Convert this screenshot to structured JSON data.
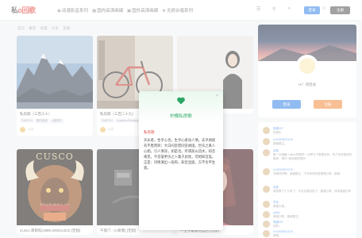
{
  "header": {
    "logo_main": "私",
    "logo_accent": "o回歌",
    "nav": [
      {
        "icon": "◉",
        "label": "动漫影音系列"
      },
      {
        "icon": "▦",
        "label": "国内高清画媒"
      },
      {
        "icon": "▣",
        "label": "国外高清画媒"
      },
      {
        "icon": "★",
        "label": "无损合唱系列"
      }
    ],
    "login_label": "登录",
    "register_label": "注册"
  },
  "breadcrumb": [
    "首页",
    "推荐",
    "动漫",
    "分享",
    "资源"
  ],
  "cards": [
    {
      "title": "私房歌（三百三十）",
      "tags": [
        "SWITCH",
        "国内高清",
        "U盘音乐"
      ],
      "author": "小闪"
    },
    {
      "title": "私房歌（三百二十九）",
      "tags": [
        "SWITCH",
        "Lossless Reading"
      ],
      "author": "小闪"
    },
    {
      "title": "",
      "tags": [],
      "author": ""
    },
    {
      "title": "Cusco 库斯科(1985-2004)14CD [无损]",
      "tags": [],
      "author": ""
    },
    {
      "title": "午夜门 - (A爱情) [无损]",
      "tags": [],
      "author": ""
    },
    {
      "title": "一生中最爱的自己 [无损]",
      "tags": [],
      "author": ""
    }
  ],
  "album_art": {
    "cusco_logo": "CUSCO",
    "cusco_sub": "APURIMAC III"
  },
  "sidebar": {
    "greeting": "Hi！请登录",
    "btn_login": "登录",
    "btn_register": "注册",
    "comments": [
      {
        "name": "偶遇007",
        "text": "好音乐"
      },
      {
        "name": "hz32628822015",
        "text": "谢谢楼主。"
      },
      {
        "name": "游客",
        "text": "第一次接触~rainer的歌声~~分享与下载很好的，听了听非常好的歌声，很好~我的感觉很好~"
      },
      {
        "name": "hz32628822015",
        "text": "非常好好歌，谢谢楼主，下次有好的资源请分享，感谢~"
      },
      {
        "name": "游客",
        "text": "我觉得了十几年了，今天总算找到了，谢谢分享，非常感谢分享~"
      },
      {
        "name": "梦游",
        "text": "谢谢大佬。"
      },
      {
        "name": "ugdly",
        "text": "谢谢分享，感谢楼主！"
      },
      {
        "name": "偶遇007",
        "text": "好好。"
      },
      {
        "name": "hz32628822015",
        "text": "好歌。"
      }
    ]
  },
  "modal": {
    "title": "柠檬私房歌",
    "close": "×",
    "subtitle": "私房歌",
    "body": "天长者，生乎心也。生乎心者动人情。夫乎闻留有不胜而转；大白同室而同室故国。世乐之真人心相。引人情深，如是也。所谓高山流水，知音难觅。今音誉更乐之人集于此地，可相知音美。正是：诗情演出一段和，知音显面，方不负平生意。"
  },
  "colors": {
    "accent_blue": "#3a85e5",
    "accent_orange": "#f38a3e",
    "brand_red": "#e0423a",
    "modal_green": "#2aa764"
  }
}
